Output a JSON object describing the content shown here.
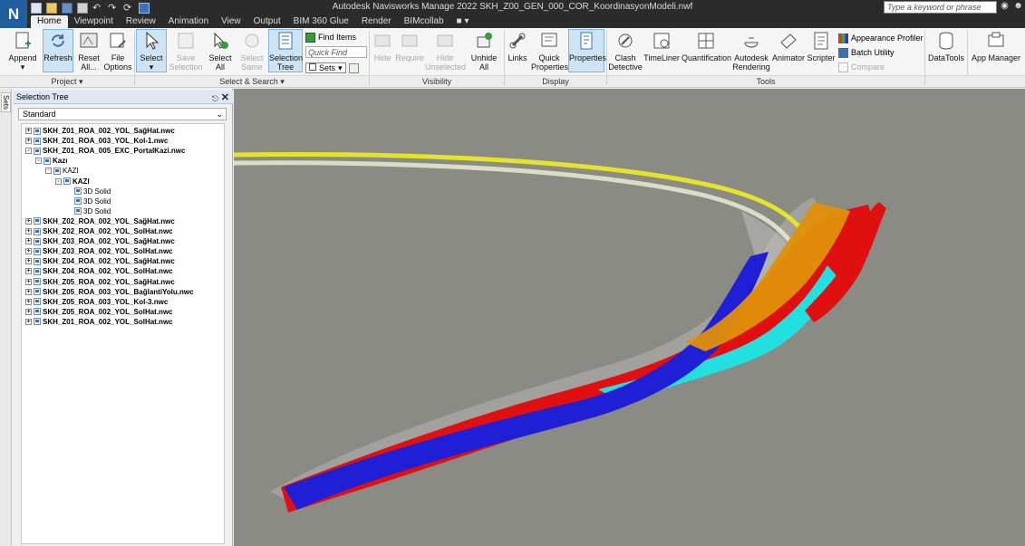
{
  "app": {
    "logo": "N",
    "title": "Autodesk Navisworks Manage 2022   SKH_Z00_GEN_000_COR_KoordinasyonModeli.nwf",
    "search_placeholder": "Type a keyword or phrase"
  },
  "menu_tabs": [
    "Home",
    "Viewpoint",
    "Review",
    "Animation",
    "View",
    "Output",
    "BIM 360 Glue",
    "Render",
    "BIMcollab"
  ],
  "ribbon": {
    "project": {
      "label": "Project",
      "append": "Append",
      "refresh": "Refresh",
      "reset_all": "Reset All...",
      "file_options": "File Options"
    },
    "select_search": {
      "label": "Select & Search",
      "select": "Select",
      "save_selection": "Save Selection",
      "select_all": "Select All",
      "select_same": "Select Same",
      "selection_tree": "Selection Tree",
      "find_items": "Find Items",
      "quick_find_placeholder": "Quick Find",
      "sets": "Sets"
    },
    "visibility": {
      "label": "Visibility",
      "hide": "Hide",
      "require": "Require",
      "hide_unselected": "Hide Unselected",
      "unhide_all": "Unhide All"
    },
    "display": {
      "label": "Display",
      "links": "Links",
      "quick_properties": "Quick Properties",
      "properties": "Properties"
    },
    "tools": {
      "label": "Tools",
      "clash_detective": "Clash Detective",
      "timeliner": "TimeLiner",
      "quantification": "Quantification",
      "autodesk_rendering": "Autodesk Rendering",
      "animator": "Animator",
      "scripter": "Scripter",
      "appearance_profiler": "Appearance Profiler",
      "batch_utility": "Batch Utility",
      "compare": "Compare"
    },
    "datatools": "DataTools",
    "app_manager": "App Manager"
  },
  "sets_tab": "Sets",
  "panel": {
    "title": "Selection Tree",
    "dropdown_value": "Standard",
    "tree": [
      {
        "label": "SKH_Z01_ROA_002_YOL_SağHat.nwc",
        "level": 0,
        "expander": "+"
      },
      {
        "label": "SKH_Z01_ROA_003_YOL_Kol-1.nwc",
        "level": 0,
        "expander": "+"
      },
      {
        "label": "SKH_Z01_ROA_005_EXC_PortalKazi.nwc",
        "level": 0,
        "expander": "-"
      },
      {
        "label": "Kazı",
        "level": 1,
        "expander": "-"
      },
      {
        "label": "KAZI",
        "level": 2,
        "expander": "-"
      },
      {
        "label": "KAZI",
        "level": 3,
        "expander": "-"
      },
      {
        "label": "3D Solid",
        "level": 4,
        "expander": ""
      },
      {
        "label": "3D Solid",
        "level": 4,
        "expander": ""
      },
      {
        "label": "3D Solid",
        "level": 4,
        "expander": ""
      },
      {
        "label": "SKH_Z02_ROA_002_YOL_SağHat.nwc",
        "level": 0,
        "expander": "+"
      },
      {
        "label": "SKH_Z02_ROA_002_YOL_SolHat.nwc",
        "level": 0,
        "expander": "+"
      },
      {
        "label": "SKH_Z03_ROA_002_YOL_SağHat.nwc",
        "level": 0,
        "expander": "+"
      },
      {
        "label": "SKH_Z03_ROA_002_YOL_SolHat.nwc",
        "level": 0,
        "expander": "+"
      },
      {
        "label": "SKH_Z04_ROA_002_YOL_SağHat.nwc",
        "level": 0,
        "expander": "+"
      },
      {
        "label": "SKH_Z04_ROA_002_YOL_SolHat.nwc",
        "level": 0,
        "expander": "+"
      },
      {
        "label": "SKH_Z05_ROA_002_YOL_SağHat.nwc",
        "level": 0,
        "expander": "+"
      },
      {
        "label": "SKH_Z05_ROA_003_YOL_BağlantiYolu.nwc",
        "level": 0,
        "expander": "+"
      },
      {
        "label": "SKH_Z05_ROA_003_YOL_Kol-3.nwc",
        "level": 0,
        "expander": "+"
      },
      {
        "label": "SKH_Z05_ROA_002_YOL_SolHat.nwc",
        "level": 0,
        "expander": "+"
      },
      {
        "label": "SKH_Z01_ROA_002_YOL_SolHat.nwc",
        "level": 0,
        "expander": "+"
      }
    ]
  },
  "colors": {
    "titlebar": "#2b2b2b",
    "viewport_bg": "#8b8b86",
    "road_blue": "#1f1fd6",
    "road_red": "#e01010",
    "road_cyan": "#22e0e0",
    "road_orange": "#e0900a",
    "road_yellow": "#e6e42a",
    "excavation_grey": "#a8a8a8",
    "selection_highlight": "#cde4f7"
  }
}
